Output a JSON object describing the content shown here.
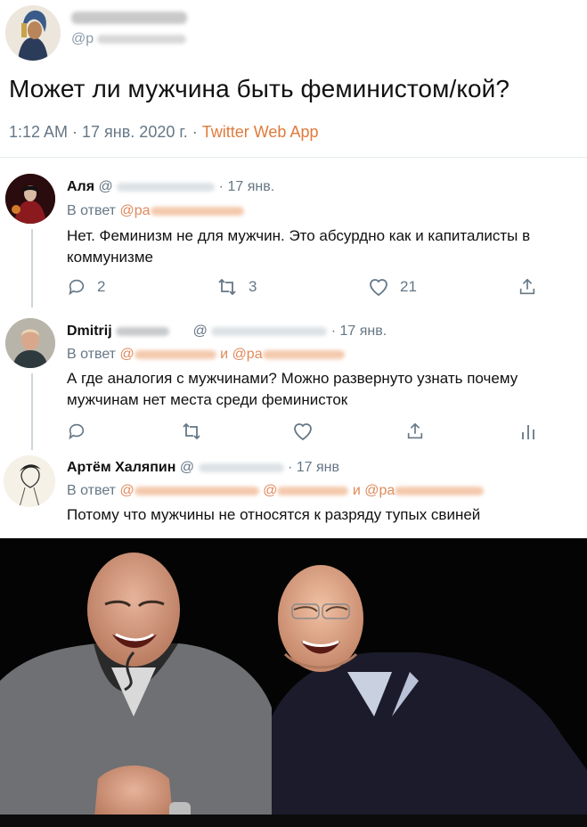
{
  "main_tweet": {
    "handle_prefix": "@p",
    "text": "Может ли мужчина быть феминистом/кой?",
    "time": "1:12 AM · 17 янв. 2020 г. ·",
    "source": "Twitter Web App"
  },
  "replies": [
    {
      "name": "Аля",
      "at": "@",
      "date": "· 17 янв.",
      "in_reply_label": "В ответ",
      "mention": "@pa",
      "text": "Нет. Феминизм не для мужчин. Это абсурдно как и  капиталисты в коммунизме",
      "reply_count": "2",
      "retweet_count": "3",
      "like_count": "21"
    },
    {
      "name": "Dmitrij",
      "at": "@",
      "date": "· 17 янв.",
      "in_reply_label": "В ответ",
      "mention_1": "@",
      "conj": "и",
      "mention_2": "@pa",
      "text": "А где аналогия с мужчинами? Можно развернуто узнать почему мужчинам нет места среди феминисток"
    },
    {
      "name": "Артём Халяпин",
      "at": "@",
      "date": "· 17 янв",
      "in_reply_label": "В ответ",
      "mention_1": "@",
      "mention_2": "@",
      "conj": "и",
      "mention_3": "@pa",
      "text": "Потому что мужчины не относятся к разряду тупых свиней"
    }
  ],
  "colors": {
    "link": "#e0895a",
    "muted": "#657786",
    "source": "#e07a3c"
  },
  "icons": [
    "reply-icon",
    "retweet-icon",
    "like-icon",
    "share-icon",
    "analytics-icon"
  ]
}
